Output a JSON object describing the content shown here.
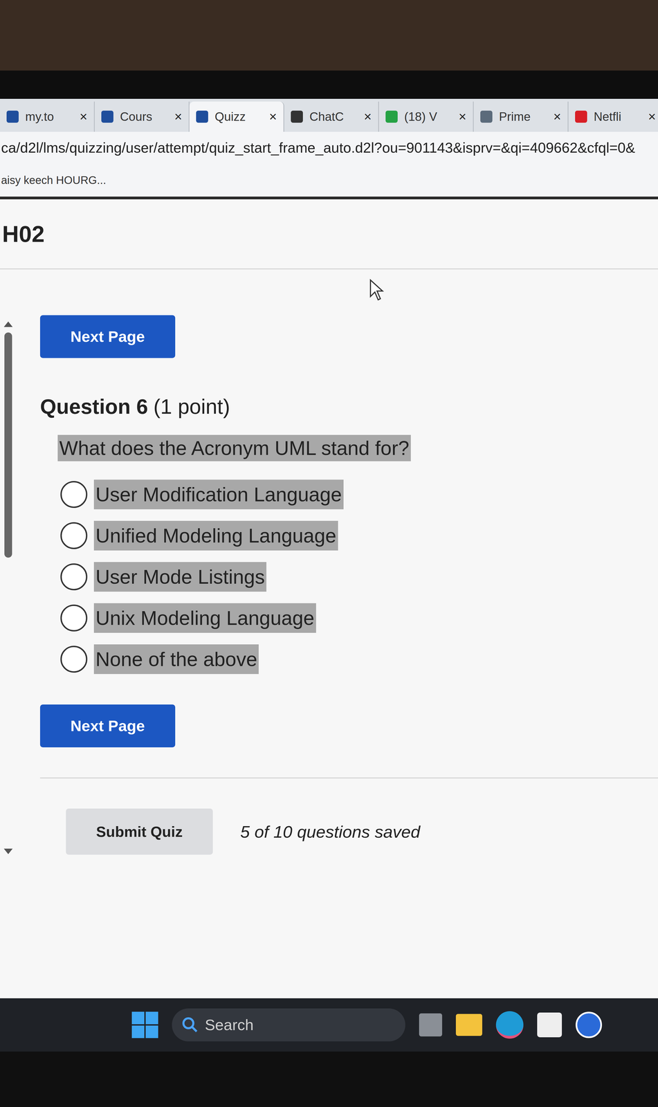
{
  "browser": {
    "tabs": [
      {
        "label": "my.to",
        "close": "×",
        "selected": false,
        "color": "#1f4e9c"
      },
      {
        "label": "Cours",
        "close": "×",
        "selected": false,
        "color": "#1f4e9c"
      },
      {
        "label": "Quizz",
        "close": "×",
        "selected": true,
        "color": "#1f4e9c"
      },
      {
        "label": "ChatC",
        "close": "×",
        "selected": false,
        "color": "#333333"
      },
      {
        "label": "(18) V",
        "close": "×",
        "selected": false,
        "color": "#25a244"
      },
      {
        "label": "Prime",
        "close": "×",
        "selected": false,
        "color": "#5b6b7b"
      },
      {
        "label": "Netfli",
        "close": "×",
        "selected": false,
        "color": "#d81f26"
      }
    ],
    "url": "ca/d2l/lms/quizzing/user/attempt/quiz_start_frame_auto.d2l?ou=901143&isprv=&qi=409662&cfql=0&",
    "bookmarks": [
      "aisy keech HOURG..."
    ]
  },
  "page": {
    "heading": "H02",
    "next_button": "Next Page",
    "question": {
      "number": "Question 6",
      "points": "(1 point)",
      "text": "What does the Acronym UML stand for?",
      "highlighted": true,
      "options": [
        {
          "label": "User Modification Language",
          "selected": false,
          "highlighted": true
        },
        {
          "label": "Unified Modeling Language",
          "selected": false,
          "highlighted": true
        },
        {
          "label": "User Mode Listings",
          "selected": false,
          "highlighted": true
        },
        {
          "label": "Unix Modeling Language",
          "selected": false,
          "highlighted": true
        },
        {
          "label": "None of the above",
          "selected": false,
          "highlighted": true
        }
      ]
    },
    "submit_button": "Submit Quiz",
    "saved_status": "5 of 10 questions saved"
  },
  "taskbar": {
    "search_placeholder": "Search"
  }
}
